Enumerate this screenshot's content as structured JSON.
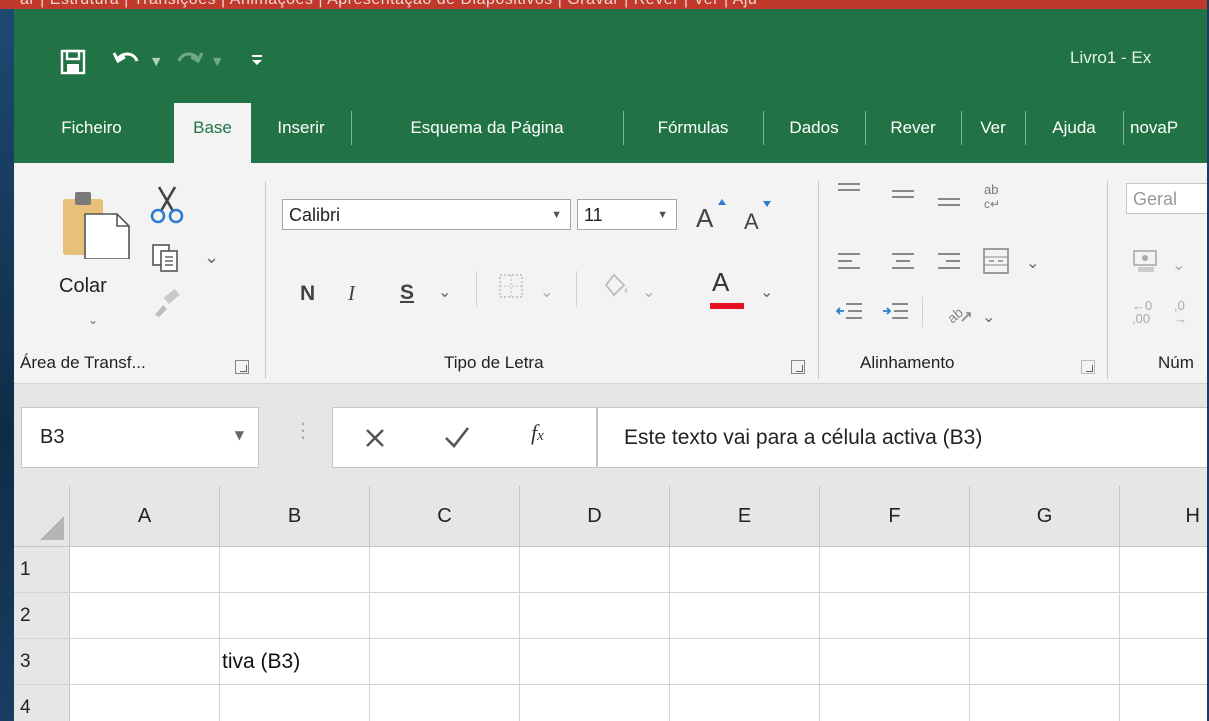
{
  "top_strip": {
    "text": "ar | Estrutura | Transições | Animações | Apresentação de Diapositivos | Gravar | Rever | Ver | Aju"
  },
  "title_bar": {
    "doc_title": "Livro1  -  Ex"
  },
  "tabs": [
    {
      "label": "Ficheiro",
      "active": false
    },
    {
      "label": "Base",
      "active": true
    },
    {
      "label": "Inserir",
      "active": false
    },
    {
      "label": "Esquema da Página",
      "active": false
    },
    {
      "label": "Fórmulas",
      "active": false
    },
    {
      "label": "Dados",
      "active": false
    },
    {
      "label": "Rever",
      "active": false
    },
    {
      "label": "Ver",
      "active": false
    },
    {
      "label": "Ajuda",
      "active": false
    },
    {
      "label": "novaP",
      "active": false
    }
  ],
  "ribbon": {
    "clipboard": {
      "paste_label": "Colar",
      "group_label": "Área de Transf..."
    },
    "font": {
      "font_name": "Calibri",
      "font_size": "11",
      "bold": "N",
      "italic": "I",
      "underline": "S",
      "font_color_glyph": "A",
      "font_color": "#e81123",
      "group_label": "Tipo de Letra"
    },
    "alignment": {
      "group_label": "Alinhamento"
    },
    "number": {
      "format": "Geral",
      "group_label": "Núm"
    }
  },
  "formula_bar": {
    "name_box": "B3",
    "formula_text": "Este texto vai para a célula activa (B3)"
  },
  "grid": {
    "columns": [
      "A",
      "B",
      "C",
      "D",
      "E",
      "F",
      "G",
      "H"
    ],
    "rows": [
      {
        "num": "1",
        "cells": [
          "",
          "",
          "",
          "",
          "",
          "",
          "",
          ""
        ]
      },
      {
        "num": "2",
        "cells": [
          "",
          "",
          "",
          "",
          "",
          "",
          "",
          ""
        ]
      },
      {
        "num": "3",
        "cells": [
          "",
          "tiva (B3)",
          "",
          "",
          "",
          "",
          "",
          ""
        ]
      },
      {
        "num": "4",
        "cells": [
          "",
          "",
          "",
          "",
          "",
          "",
          "",
          ""
        ]
      }
    ]
  },
  "colors": {
    "excel_green": "#217346",
    "ribbon_bg": "#f3f3f3"
  }
}
